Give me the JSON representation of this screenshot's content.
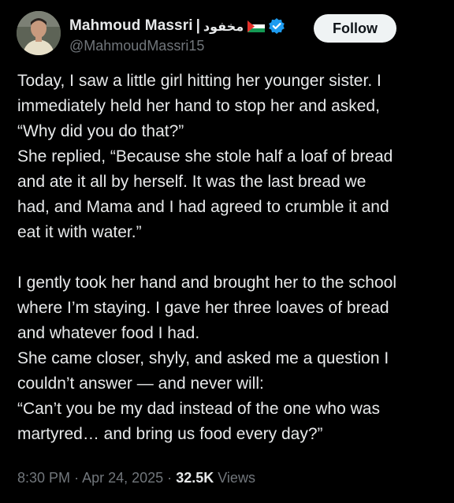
{
  "author": {
    "display_name": "Mahmoud Massri",
    "separator": "|",
    "arabic_name": "مخفود",
    "handle": "@MahmoudMassri15",
    "flag_icon": "palestine-flag-icon",
    "verified_icon": "verified-badge-icon",
    "verified_color": "#1d9bf0"
  },
  "follow_button": {
    "label": "Follow"
  },
  "tweet": {
    "lines": [
      "Today, I saw a little girl hitting her younger sister. I",
      "immediately held her hand to stop her and asked,",
      "“Why did you do that?”",
      "She replied, “Because she stole half a loaf of bread",
      "and ate it all by herself. It was the last bread we",
      "had, and Mama and I had agreed to crumble it and",
      "eat it with water.”",
      "",
      "I gently took her hand and brought her to the school",
      "where I’m staying. I gave her three loaves of bread",
      "and whatever food I had.",
      "She came closer, shyly, and asked me a question I",
      "couldn’t answer — and never will:",
      "“Can’t you be my dad instead of the one who was",
      "martyred… and bring us food every day?”"
    ]
  },
  "meta": {
    "time": "8:30 PM",
    "dot": "·",
    "date": "Apr 24, 2025",
    "views_count": "32.5K",
    "views_label": "Views"
  },
  "colors": {
    "background": "#000000",
    "primary_text": "#e7e9ea",
    "secondary_text": "#71767b",
    "follow_bg": "#eff3f4",
    "follow_text": "#0f1419"
  }
}
